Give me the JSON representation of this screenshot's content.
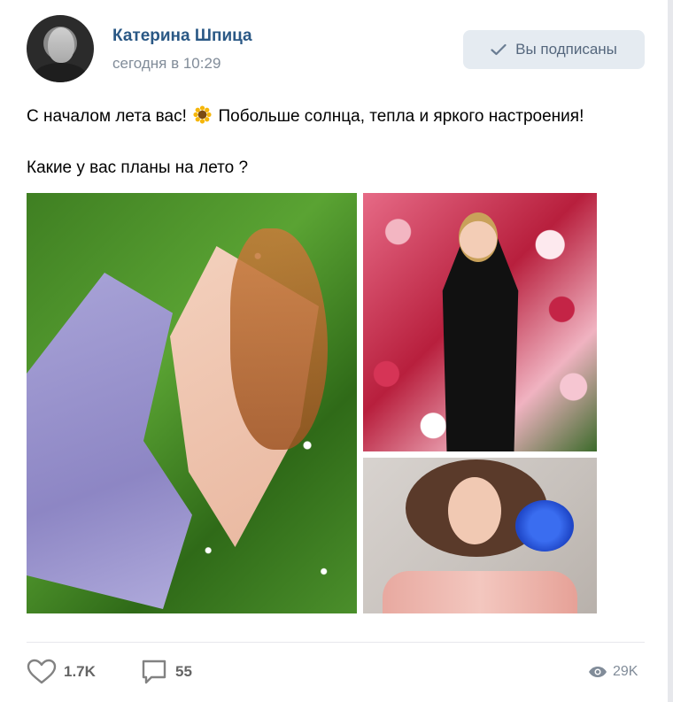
{
  "post": {
    "author": "Катерина Шпица",
    "time": "сегодня в 10:29",
    "subscribe_label": "Вы подписаны",
    "text_line1_a": "С началом лета вас!",
    "text_line1_b": "Побольше солнца, тепла и яркого настроения!",
    "text_line2": "Какие у вас планы на лето ?",
    "emoji": "sunflower-icon"
  },
  "footer": {
    "likes": "1.7K",
    "comments": "55",
    "views": "29K"
  },
  "colors": {
    "author_link": "#2a5885",
    "muted": "#818c99",
    "button_bg": "#e5ebf1"
  }
}
